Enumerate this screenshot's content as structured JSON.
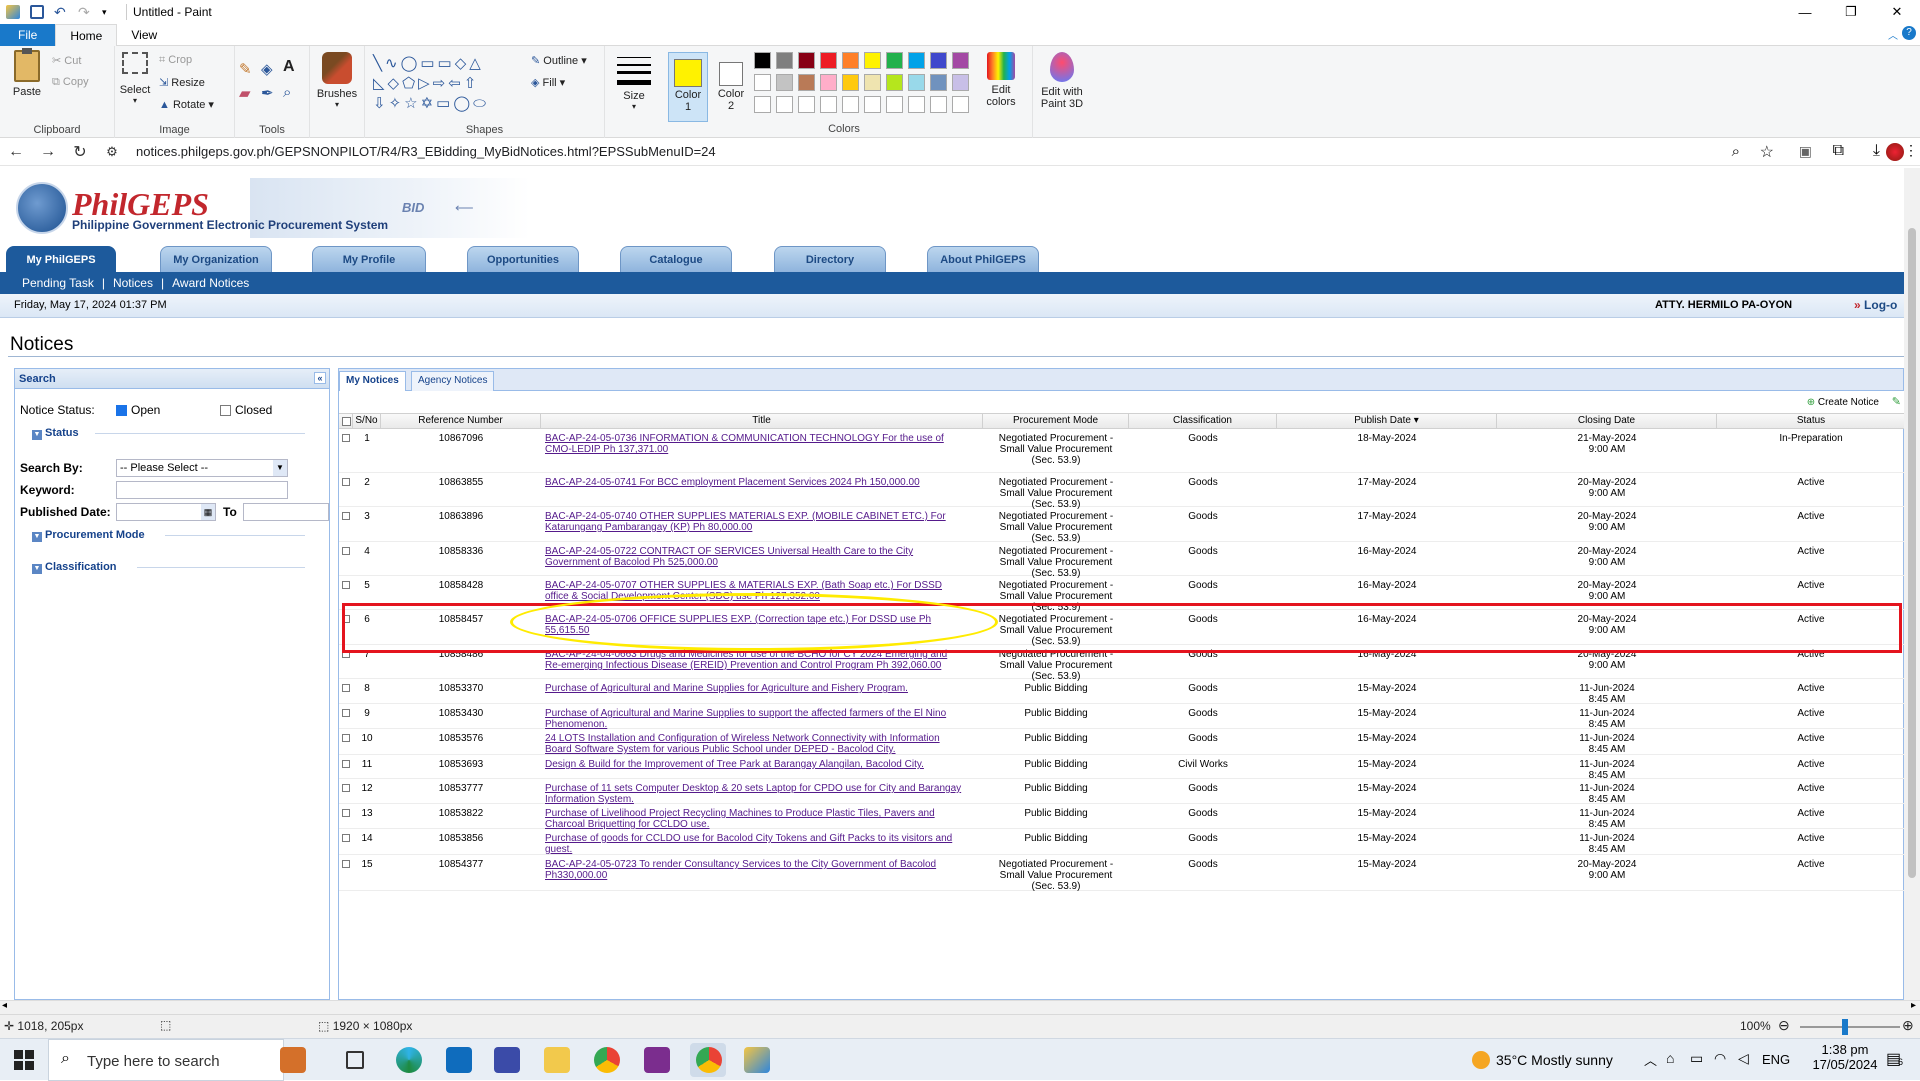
{
  "window": {
    "title": "Untitled - Paint",
    "controls": [
      "—",
      "❐",
      "✕"
    ]
  },
  "ribbon": {
    "tabs": [
      "File",
      "Home",
      "View"
    ],
    "clipboard": {
      "paste": "Paste",
      "cut": "Cut",
      "copy": "Copy",
      "label": "Clipboard"
    },
    "image": {
      "select": "Select",
      "crop": "Crop",
      "resize": "Resize",
      "rotate": "Rotate",
      "label": "Image"
    },
    "tools": {
      "label": "Tools"
    },
    "brushes": "Brushes",
    "shapes": {
      "outline": "Outline",
      "fill": "Fill",
      "label": "Shapes"
    },
    "size": "Size",
    "color1": "Color 1",
    "color2": "Color 2",
    "colors_label": "Colors",
    "edit_colors": "Edit colors",
    "edit_paint3d": "Edit with Paint 3D",
    "palette": [
      "#000000",
      "#7f7f7f",
      "#880015",
      "#ed1c24",
      "#ff7f27",
      "#fff200",
      "#22b14c",
      "#00a2e8",
      "#3f48cc",
      "#a349a4",
      "#ffffff",
      "#c3c3c3",
      "#b97a57",
      "#ffaec9",
      "#ffc90e",
      "#efe4b0",
      "#b5e61d",
      "#99d9ea",
      "#7092be",
      "#c8bfe7"
    ],
    "color1_value": "#fff200",
    "color2_value": "#ffffff"
  },
  "browser": {
    "url": "notices.philgeps.gov.ph/GEPSNONPILOT/R4/R3_EBidding_MyBidNotices.html?EPSSubMenuID=24"
  },
  "site": {
    "logo_title": "PhilGEPS",
    "logo_subtitle": "Philippine Government Electronic Procurement System",
    "banner_text": "BID",
    "nav_tabs": [
      "My PhilGEPS",
      "My Organization",
      "My Profile",
      "Opportunities",
      "Catalogue",
      "Directory",
      "About PhilGEPS"
    ],
    "sub_nav": [
      "Pending Task",
      "Notices",
      "Award Notices"
    ],
    "date_text": "Friday, May 17, 2024 01:37 PM",
    "user_name": "ATTY. HERMILO PA-OYON",
    "logout": "Log-o",
    "page_title": "Notices"
  },
  "search": {
    "header": "Search",
    "notice_status_label": "Notice Status:",
    "open_label": "Open",
    "closed_label": "Closed",
    "open_checked": true,
    "closed_checked": false,
    "status_section": "Status",
    "search_by_label": "Search By:",
    "search_by_value": "-- Please Select --",
    "keyword_label": "Keyword:",
    "published_date_label": "Published Date:",
    "to_label": "To",
    "procurement_mode_section": "Procurement Mode",
    "classification_section": "Classification"
  },
  "grid": {
    "tabs": [
      "My Notices",
      "Agency Notices"
    ],
    "create_notice": "Create Notice",
    "columns": [
      "S/No",
      "Reference Number",
      "Title",
      "Procurement Mode",
      "Classification",
      "Publish Date",
      "Closing Date",
      "Status"
    ],
    "rows": [
      {
        "sno": "1",
        "ref": "10867096",
        "title1": "BAC-AP-24-05-0736  INFORMATION & COMMUNICATION TECHNOLOGY  For the use of",
        "title2": "CMO-LEDIP  Ph 137,371.00",
        "mode1": "Negotiated Procurement -",
        "mode2": "Small Value Procurement",
        "mode3": "(Sec. 53.9)",
        "class": "Goods",
        "publish": "18-May-2024",
        "close1": "21-May-2024",
        "close2": "9:00 AM",
        "status": "In-Preparation"
      },
      {
        "sno": "2",
        "ref": "10863855",
        "title1": "BAC-AP-24-05-0741  For BCC employment Placement Services 2024  Ph 150,000.00",
        "title2": "",
        "mode1": "Negotiated Procurement -",
        "mode2": "Small Value Procurement",
        "mode3": "(Sec. 53.9)",
        "class": "Goods",
        "publish": "17-May-2024",
        "close1": "20-May-2024",
        "close2": "9:00 AM",
        "status": "Active"
      },
      {
        "sno": "3",
        "ref": "10863896",
        "title1": "BAC-AP-24-05-0740 OTHER SUPPLIES MATERIALS EXP. (MOBILE CABINET ETC.) For",
        "title2": "Katarungang Pambarangay (KP)  Ph 80,000.00",
        "mode1": "Negotiated Procurement -",
        "mode2": "Small Value Procurement",
        "mode3": "(Sec. 53.9)",
        "class": "Goods",
        "publish": "17-May-2024",
        "close1": "20-May-2024",
        "close2": "9:00 AM",
        "status": "Active"
      },
      {
        "sno": "4",
        "ref": "10858336",
        "title1": "BAC-AP-24-05-0722 CONTRACT OF SERVICES Universal Health Care  to the City",
        "title2": "Government of Bacolod Ph 525,000.00",
        "mode1": "Negotiated Procurement -",
        "mode2": "Small Value Procurement",
        "mode3": "(Sec. 53.9)",
        "class": "Goods",
        "publish": "16-May-2024",
        "close1": "20-May-2024",
        "close2": "9:00 AM",
        "status": "Active"
      },
      {
        "sno": "5",
        "ref": "10858428",
        "title1": "BAC-AP-24-05-0707 OTHER SUPPLIES & MATERIALS EXP. (Bath Soap etc.) For DSSD",
        "title2": "office & Social Development Center (SDC) use  Ph 127,352.00",
        "mode1": "Negotiated Procurement -",
        "mode2": "Small Value Procurement",
        "mode3": "(Sec. 53.9)",
        "class": "Goods",
        "publish": "16-May-2024",
        "close1": "20-May-2024",
        "close2": "9:00 AM",
        "status": "Active"
      },
      {
        "sno": "6",
        "ref": "10858457",
        "title1": "BAC-AP-24-05-0706 OFFICE SUPPLIES EXP. (Correction tape etc.) For DSSD use  Ph",
        "title2": "55,615.50",
        "mode1": "Negotiated Procurement -",
        "mode2": "Small Value Procurement",
        "mode3": "(Sec. 53.9)",
        "class": "Goods",
        "publish": "16-May-2024",
        "close1": "20-May-2024",
        "close2": "9:00 AM",
        "status": "Active"
      },
      {
        "sno": "7",
        "ref": "10858486",
        "title1": "BAC-AP-24-04-0663 Drugs and Medicines for use of the BCHO for CY 2024 Emerging and",
        "title2": "Re-emerging Infectious Disease (EREID) Prevention and Control Program  Ph 392,060.00",
        "mode1": "Negotiated Procurement -",
        "mode2": "Small Value Procurement",
        "mode3": "(Sec. 53.9)",
        "class": "Goods",
        "publish": "16-May-2024",
        "close1": "20-May-2024",
        "close2": "9:00 AM",
        "status": "Active"
      },
      {
        "sno": "8",
        "ref": "10853370",
        "title1": "Purchase of Agricultural and Marine Supplies for Agriculture and Fishery Program.",
        "title2": "",
        "mode1": "Public Bidding",
        "mode2": "",
        "mode3": "",
        "class": "Goods",
        "publish": "15-May-2024",
        "close1": "11-Jun-2024",
        "close2": "8:45 AM",
        "status": "Active"
      },
      {
        "sno": "9",
        "ref": "10853430",
        "title1": "Purchase of Agricultural and Marine Supplies to support the affected farmers of the El Nino",
        "title2": "Phenomenon.",
        "mode1": "Public Bidding",
        "mode2": "",
        "mode3": "",
        "class": "Goods",
        "publish": "15-May-2024",
        "close1": "11-Jun-2024",
        "close2": "8:45 AM",
        "status": "Active"
      },
      {
        "sno": "10",
        "ref": "10853576",
        "title1": "24 LOTS Installation and Configuration of Wireless Network Connectivity with Information",
        "title2": "Board Software System for various Public School under DEPED - Bacolod City.",
        "mode1": "Public Bidding",
        "mode2": "",
        "mode3": "",
        "class": "Goods",
        "publish": "15-May-2024",
        "close1": "11-Jun-2024",
        "close2": "8:45 AM",
        "status": "Active"
      },
      {
        "sno": "11",
        "ref": "10853693",
        "title1": "Design & Build for the Improvement of Tree Park at Barangay Alangilan, Bacolod City.",
        "title2": "",
        "mode1": "Public Bidding",
        "mode2": "",
        "mode3": "",
        "class": "Civil Works",
        "publish": "15-May-2024",
        "close1": "11-Jun-2024",
        "close2": "8:45 AM",
        "status": "Active"
      },
      {
        "sno": "12",
        "ref": "10853777",
        "title1": "Purchase of 11 sets Computer Desktop & 20 sets Laptop for CPDO use for City and Barangay",
        "title2": "Information System.",
        "mode1": "Public Bidding",
        "mode2": "",
        "mode3": "",
        "class": "Goods",
        "publish": "15-May-2024",
        "close1": "11-Jun-2024",
        "close2": "8:45 AM",
        "status": "Active"
      },
      {
        "sno": "13",
        "ref": "10853822",
        "title1": "Purchase of Livelihood Project Recycling Machines to Produce Plastic Tiles, Pavers and",
        "title2": "Charcoal Briquetting for CCLDO use.",
        "mode1": "Public Bidding",
        "mode2": "",
        "mode3": "",
        "class": "Goods",
        "publish": "15-May-2024",
        "close1": "11-Jun-2024",
        "close2": "8:45 AM",
        "status": "Active"
      },
      {
        "sno": "14",
        "ref": "10853856",
        "title1": "Purchase of goods for CCLDO use for Bacolod City Tokens and Gift Packs to its visitors and",
        "title2": "guest.",
        "mode1": "Public Bidding",
        "mode2": "",
        "mode3": "",
        "class": "Goods",
        "publish": "15-May-2024",
        "close1": "11-Jun-2024",
        "close2": "8:45 AM",
        "status": "Active"
      },
      {
        "sno": "15",
        "ref": "10854377",
        "title1": "BAC-AP-24-05-0723 To render Consultancy Services to the City Government of Bacolod",
        "title2": "Ph330,000.00",
        "mode1": "Negotiated Procurement -",
        "mode2": "Small Value Procurement",
        "mode3": "(Sec. 53.9)",
        "class": "Goods",
        "publish": "15-May-2024",
        "close1": "20-May-2024",
        "close2": "9:00 AM",
        "status": "Active"
      }
    ]
  },
  "statusbar": {
    "cursor": "1018, 205px",
    "dims": "1920 × 1080px",
    "zoom": "100%"
  },
  "taskbar": {
    "search_placeholder": "Type here to search",
    "weather": "35°C  Mostly sunny",
    "lang": "ENG",
    "time": "1:38 pm",
    "date": "17/05/2024",
    "notif_count": "6"
  }
}
